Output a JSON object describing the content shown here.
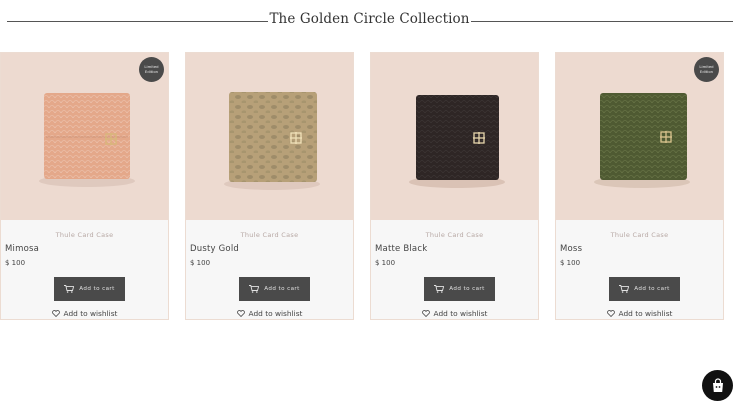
{
  "page": {
    "title": "The Golden Circle Collection"
  },
  "products": [
    {
      "subtitle": "Thule Card Case",
      "name": "Mimosa",
      "price": "$ 100",
      "badge": "Limited Edition",
      "cart_label": "Add to cart",
      "wishlist_label": "Add to wishlist",
      "bg_color": "#eddad0",
      "wallet_color": "#e4a88a"
    },
    {
      "subtitle": "Thule Card Case",
      "name": "Dusty Gold",
      "price": "$ 100",
      "badge": "",
      "cart_label": "Add to cart",
      "wishlist_label": "Add to wishlist",
      "bg_color": "#eddad0",
      "wallet_color": "#b7a078"
    },
    {
      "subtitle": "Thule Card Case",
      "name": "Matte Black",
      "price": "$ 100",
      "badge": "",
      "cart_label": "Add to cart",
      "wishlist_label": "Add to wishlist",
      "bg_color": "#eddad0",
      "wallet_color": "#2e2625"
    },
    {
      "subtitle": "Thule Card Case",
      "name": "Moss",
      "price": "$ 100",
      "badge": "Limited Edition",
      "cart_label": "Add to cart",
      "wishlist_label": "Add to wishlist",
      "bg_color": "#eddad0",
      "wallet_color": "#4f5a32"
    }
  ],
  "fab": {
    "icon": "shopping-bag-icon"
  }
}
